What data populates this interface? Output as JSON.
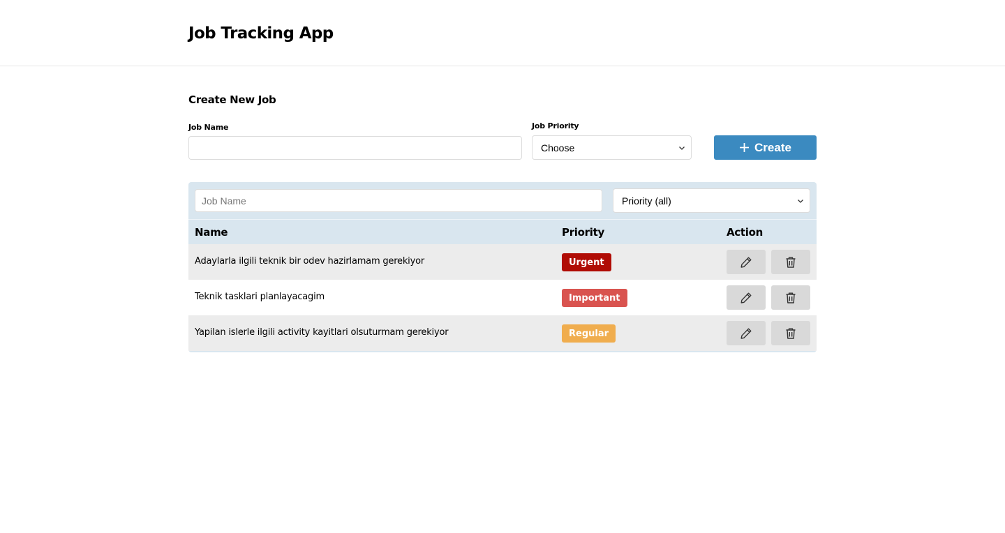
{
  "header": {
    "title": "Job Tracking App"
  },
  "create_form": {
    "title": "Create New Job",
    "job_name_label": "Job Name",
    "job_name_value": "",
    "job_priority_label": "Job Priority",
    "job_priority_selected": "Choose",
    "create_button_label": "Create"
  },
  "filter": {
    "search_placeholder": "Job Name",
    "priority_selected": "Priority (all)"
  },
  "table": {
    "columns": [
      "Name",
      "Priority",
      "Action"
    ],
    "rows": [
      {
        "name": "Adaylarla ilgili teknik bir odev hazirlamam gerekiyor",
        "priority": "Urgent",
        "priority_color": "#b00c05",
        "row_bg": "#ececec"
      },
      {
        "name": "Teknik tasklari planlayacagim",
        "priority": "Important",
        "priority_color": "#d9534f",
        "row_bg": "#ffffff"
      },
      {
        "name": "Yapilan islerle ilgili activity kayitlari olsuturmam gerekiyor",
        "priority": "Regular",
        "priority_color": "#f0ad4e",
        "row_bg": "#ececec"
      }
    ]
  },
  "icons": {
    "create": "plus-icon",
    "edit": "pencil-icon",
    "delete": "trash-icon",
    "dropdown": "chevron-down-icon"
  },
  "colors": {
    "accent": "#3b8ac0",
    "panel_bg": "#d9e6ef",
    "action_button_bg": "#d9d9d9"
  }
}
